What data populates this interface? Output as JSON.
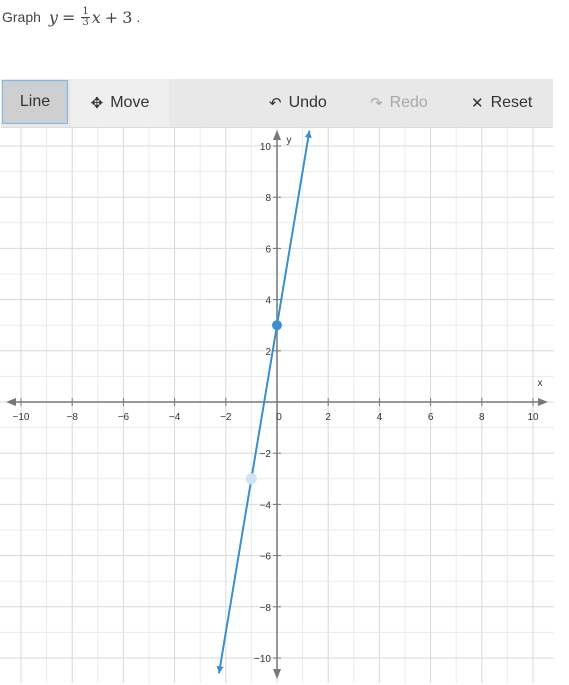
{
  "prompt": {
    "lead": "Graph",
    "lhs": "y",
    "eq": "=",
    "frac_num": "1",
    "frac_den": "3",
    "rhs_var": "x",
    "plus": "+",
    "const": "3",
    "tail": "."
  },
  "toolbar": {
    "line_label": "Line",
    "move_label": "Move",
    "undo_label": "Undo",
    "redo_label": "Redo",
    "reset_label": "Reset",
    "move_icon": "✥",
    "undo_icon": "↶",
    "redo_icon": "↷",
    "reset_icon": "✕"
  },
  "chart_data": {
    "type": "line",
    "xlabel": "x",
    "ylabel": "y",
    "xlim": [
      -10,
      10
    ],
    "ylim": [
      -10,
      10
    ],
    "grid": true,
    "x_ticks": [
      "−10",
      "−8",
      "−6",
      "−4",
      "−2",
      "0",
      "2",
      "4",
      "6",
      "8",
      "10"
    ],
    "y_ticks": [
      "10",
      "8",
      "6",
      "4",
      "2",
      "−2",
      "−4",
      "−6",
      "−8",
      "−10"
    ],
    "plotted_line": {
      "point_a": [
        0,
        3
      ],
      "point_b": [
        -1,
        -3
      ],
      "slope": 6,
      "intercept": 3,
      "color": "#3b8fce"
    }
  }
}
